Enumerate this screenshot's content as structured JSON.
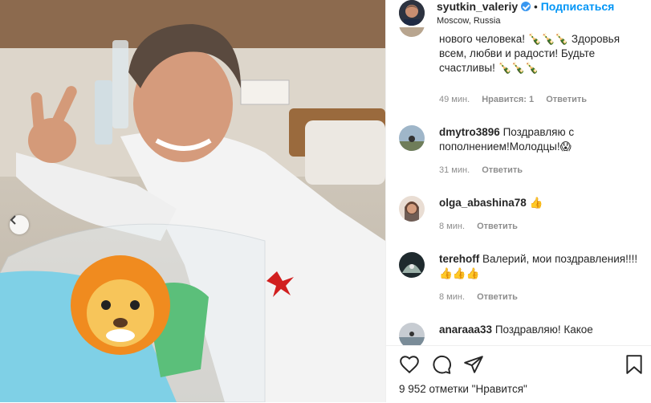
{
  "header": {
    "username": "syutkin_valeriy",
    "separator": "•",
    "follow_label": "Подписаться",
    "location": "Moscow, Russia"
  },
  "comments": [
    {
      "username": "",
      "text": "нового человека! 🍾🍾🍾 Здоровья всем, любви и радости! Будьте счастливы! 🍾🍾🍾",
      "time": "49 мин.",
      "likes": "Нравится: 1",
      "reply": "Ответить"
    },
    {
      "username": "dmytro3896",
      "text": "Поздравляю с пополнением!Молодцы!😱",
      "time": "31 мин.",
      "reply": "Ответить"
    },
    {
      "username": "olga_abashina78",
      "text": "👍",
      "time": "8 мин.",
      "reply": "Ответить"
    },
    {
      "username": "terehoff",
      "text": "Валерий, мои поздравления!!!! 👍👍👍",
      "time": "8 мин.",
      "reply": "Ответить"
    },
    {
      "username": "anaraaa33",
      "text": "Поздравляю! Какое",
      "time": "",
      "reply": ""
    }
  ],
  "footer": {
    "likes_text": "9 952 отметки \"Нравится\""
  },
  "colors": {
    "accent": "#0095f6",
    "verified": "#3897f0",
    "text": "#262626",
    "muted": "#8e8e8e"
  },
  "icons": [
    "heart-icon",
    "comment-icon",
    "share-icon",
    "bookmark-icon",
    "verified-icon",
    "chevron-left-icon"
  ]
}
